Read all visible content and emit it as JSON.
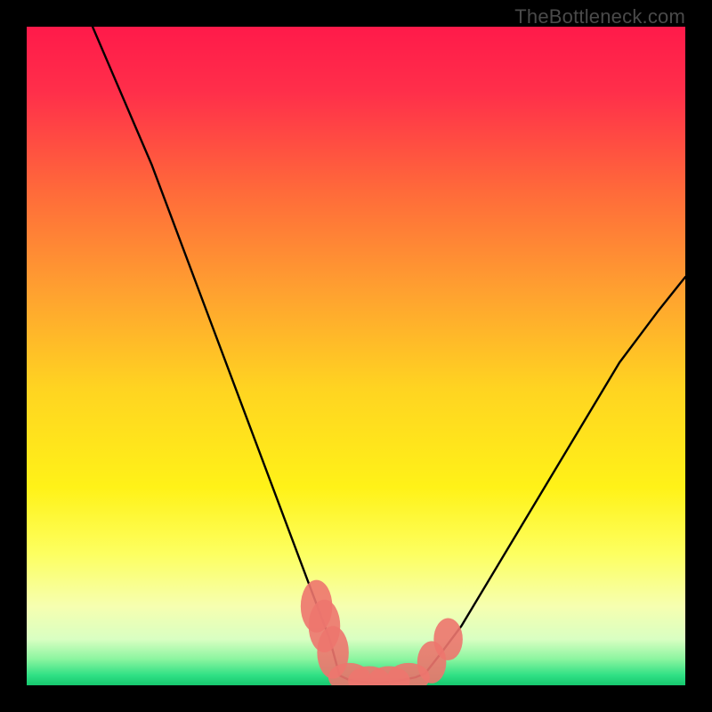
{
  "watermark": "TheBottleneck.com",
  "chart_data": {
    "type": "line",
    "title": "",
    "xlabel": "",
    "ylabel": "",
    "xlim": [
      0,
      100
    ],
    "ylim": [
      0,
      100
    ],
    "background_gradient": {
      "stops": [
        {
          "offset": 0.0,
          "color": "#ff1a4a"
        },
        {
          "offset": 0.1,
          "color": "#ff2f4a"
        },
        {
          "offset": 0.25,
          "color": "#ff6a3a"
        },
        {
          "offset": 0.4,
          "color": "#ffa030"
        },
        {
          "offset": 0.55,
          "color": "#ffd421"
        },
        {
          "offset": 0.7,
          "color": "#fff218"
        },
        {
          "offset": 0.8,
          "color": "#fdff60"
        },
        {
          "offset": 0.88,
          "color": "#f6ffb0"
        },
        {
          "offset": 0.93,
          "color": "#d9ffc2"
        },
        {
          "offset": 0.96,
          "color": "#8cf5a0"
        },
        {
          "offset": 0.985,
          "color": "#2fe084"
        },
        {
          "offset": 1.0,
          "color": "#16c76e"
        }
      ]
    },
    "series": [
      {
        "name": "left-curve",
        "stroke": "#000000",
        "stroke_width": 2.4,
        "x": [
          10,
          13,
          16,
          19,
          22,
          25,
          28,
          31,
          34,
          37,
          40,
          43,
          46,
          47.5
        ],
        "y": [
          100,
          93,
          86,
          79,
          71,
          63,
          55,
          47,
          39,
          31,
          23,
          15,
          7,
          1.5
        ]
      },
      {
        "name": "valley-floor",
        "stroke": "#000000",
        "stroke_width": 2.4,
        "x": [
          47.5,
          49,
          51,
          53,
          55,
          57,
          59,
          60.5
        ],
        "y": [
          1.5,
          0.8,
          0.5,
          0.4,
          0.5,
          0.8,
          1.2,
          1.8
        ]
      },
      {
        "name": "right-curve",
        "stroke": "#000000",
        "stroke_width": 2.4,
        "x": [
          60.5,
          63,
          66,
          69,
          72,
          75,
          78,
          81,
          84,
          87,
          90,
          93,
          96,
          100
        ],
        "y": [
          1.8,
          5,
          9,
          14,
          19,
          24,
          29,
          34,
          39,
          44,
          49,
          53,
          57,
          62
        ]
      }
    ],
    "markers": [
      {
        "x": 44.0,
        "y": 12.0,
        "rx": 2.4,
        "ry": 4.0,
        "color": "#ed766e"
      },
      {
        "x": 45.2,
        "y": 9.0,
        "rx": 2.4,
        "ry": 4.0,
        "color": "#ed766e"
      },
      {
        "x": 46.5,
        "y": 5.0,
        "rx": 2.4,
        "ry": 4.0,
        "color": "#ed766e"
      },
      {
        "x": 49.0,
        "y": 1.2,
        "rx": 3.2,
        "ry": 2.2,
        "color": "#ed766e"
      },
      {
        "x": 52.0,
        "y": 0.7,
        "rx": 3.2,
        "ry": 2.2,
        "color": "#ed766e"
      },
      {
        "x": 55.0,
        "y": 0.7,
        "rx": 3.2,
        "ry": 2.2,
        "color": "#ed766e"
      },
      {
        "x": 58.0,
        "y": 1.2,
        "rx": 3.2,
        "ry": 2.2,
        "color": "#ed766e"
      },
      {
        "x": 61.5,
        "y": 3.5,
        "rx": 2.2,
        "ry": 3.2,
        "color": "#ed766e"
      },
      {
        "x": 64.0,
        "y": 7.0,
        "rx": 2.2,
        "ry": 3.2,
        "color": "#ed766e"
      }
    ]
  }
}
